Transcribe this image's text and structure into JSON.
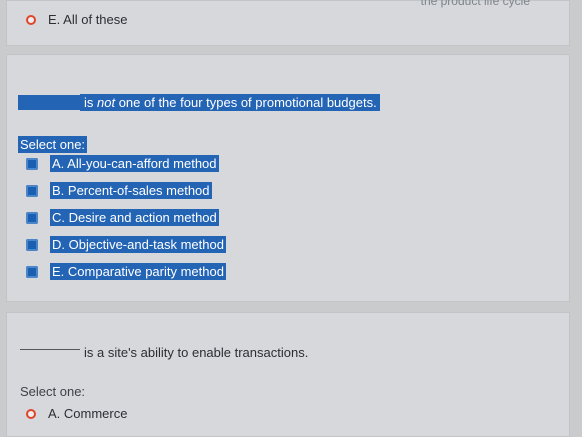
{
  "top_card": {
    "faint_text": "the product life cycle",
    "option_e": "E. All of these"
  },
  "question2": {
    "text": "is not one of the four types of promotional budgets.",
    "text_not": "not",
    "text_pre": "is ",
    "text_post": " one of the four types of promotional budgets.",
    "select_one": "Select one:",
    "options": [
      "A. All-you-can-afford method",
      "B. Percent-of-sales method",
      "C. Desire and action method",
      "D. Objective-and-task method",
      "E. Comparative parity method"
    ]
  },
  "question3": {
    "text": "is a site's ability to enable transactions.",
    "select_one": "Select one:",
    "options": [
      "A. Commerce"
    ]
  }
}
